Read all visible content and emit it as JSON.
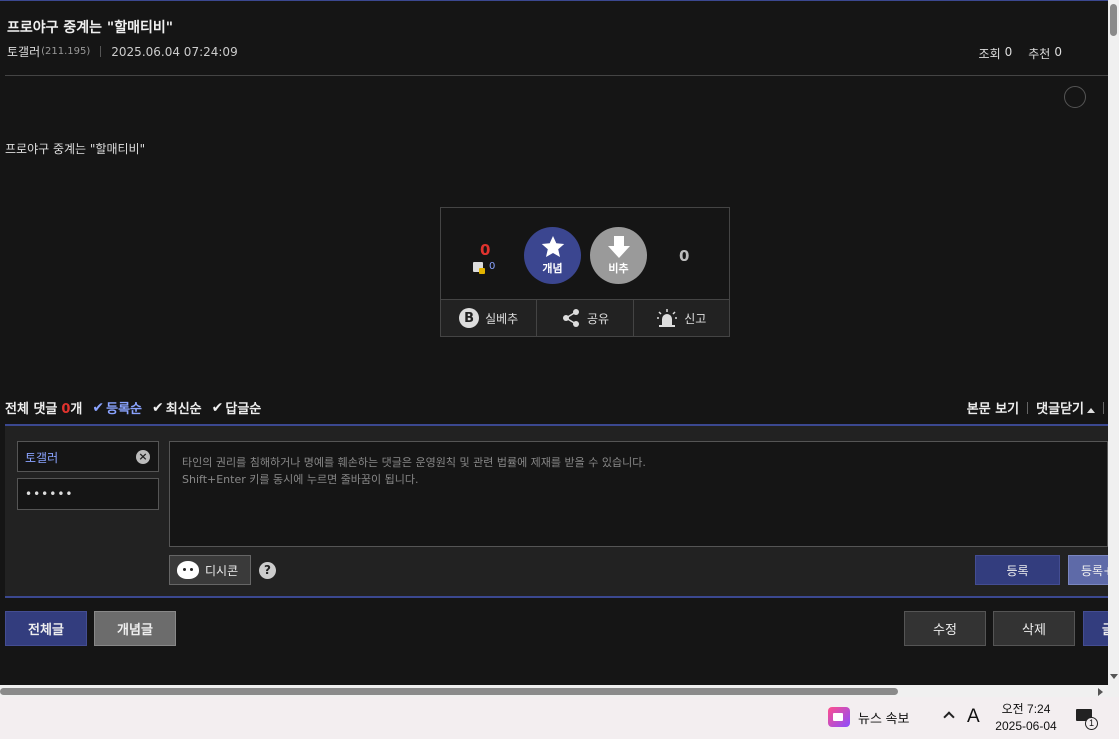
{
  "post": {
    "title": "프로야구 중계는 \"할매티비\"",
    "author": "토갤러",
    "author_ip": "(211.195)",
    "date": "2025.06.04 07:24:09",
    "views_label": "조회",
    "views": "0",
    "recommend_label": "추천",
    "recommend": "0",
    "body": "프로야구 중계는 \"할매티비\""
  },
  "vote": {
    "up_count": "0",
    "fix_count": "0",
    "up_label": "개념",
    "down_label": "비추",
    "down_count": "0",
    "actions": {
      "best": "실베추",
      "share": "공유",
      "report": "신고"
    }
  },
  "comments": {
    "total_label": "전체 댓글",
    "count": "0",
    "count_unit": "개",
    "sort": [
      "등록순",
      "최신순",
      "답글순"
    ],
    "view_body": "본문 보기",
    "close": "댓글닫기"
  },
  "form": {
    "name": "토갤러",
    "password": "••••••",
    "memo_line1": "타인의 권리를 침해하거나 명예를 훼손하는 댓글은 운영원칙 및 관련 법률에 제재를 받을 수 있습니다.",
    "memo_line2": "Shift+Enter 키를 동시에 누르면 줄바꿈이 됩니다.",
    "dccon": "디시콘",
    "help": "?",
    "register": "등록",
    "register_plus": "등록+"
  },
  "bottom": {
    "all_posts": "전체글",
    "best_posts": "개념글",
    "edit": "수정",
    "delete": "삭제",
    "write": "글"
  },
  "taskbar": {
    "news": "뉴스 속보",
    "ime": "A",
    "time": "오전 7:24",
    "date": "2025-06-04",
    "notif_count": "1"
  }
}
